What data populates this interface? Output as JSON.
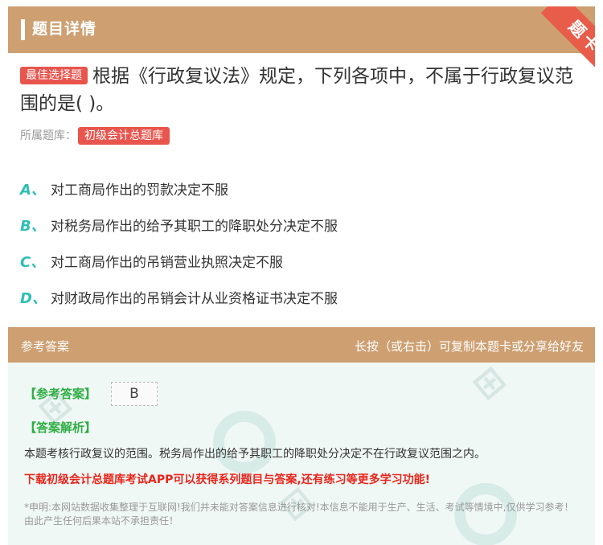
{
  "header": {
    "title": "题目详情",
    "ribbon": "题卡"
  },
  "question": {
    "type_tag": "最佳选择题",
    "text": "根据《行政复议法》规定，下列各项中，不属于行政复议范围的是( )。",
    "bank_label": "所属题库：",
    "bank_name": "初级会计总题库"
  },
  "options": [
    {
      "letter": "A、",
      "text": "对工商局作出的罚款决定不服"
    },
    {
      "letter": "B、",
      "text": "对税务局作出的给予其职工的降职处分决定不服"
    },
    {
      "letter": "C、",
      "text": "对工商局作出的吊销营业执照决定不服"
    },
    {
      "letter": "D、",
      "text": "对财政局作出的吊销会计从业资格证书决定不服"
    }
  ],
  "answer_section": {
    "title": "参考答案",
    "hint": "长按（或右击）可复制本题卡或分享给好友",
    "answer_label": "【参考答案】",
    "answer_value": "B",
    "explanation_label": "【答案解析】",
    "explanation": "本题考核行政复议的范围。税务局作出的给予其职工的降职处分决定不在行政复议范围之内。",
    "promo": "下载初级会计总题库考试APP可以获得系列题目与答案,还有练习等更多学习功能!",
    "disclaimer": "*申明:本网站数据收集整理于互联网!我们并未能对答案信息进行核对!本信息不能用于生产、生活、考试等情境中,仅供学习参考！由此产生任何后果本站不承担责任！"
  },
  "colors": {
    "header_bg": "#cd9f71",
    "accent_red": "#e8554d",
    "option_letter": "#2fbfb4",
    "label_green": "#2fae44",
    "promo_red": "#e8251b"
  }
}
